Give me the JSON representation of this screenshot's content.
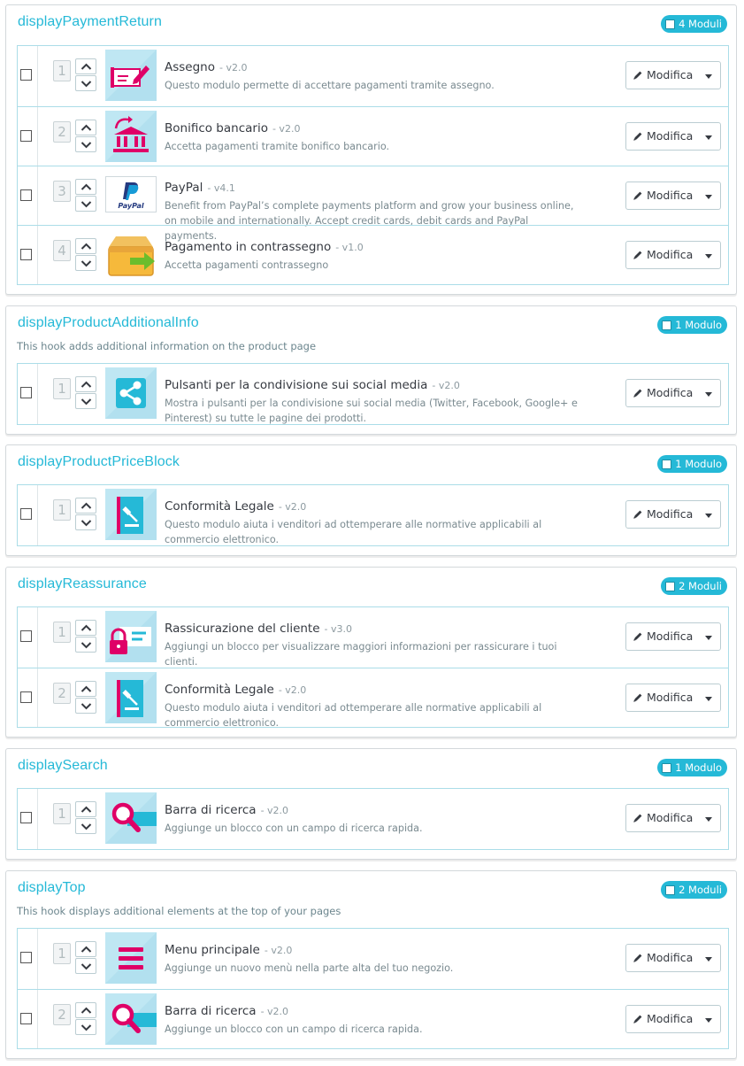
{
  "edit_label": "Modifica",
  "hooks": [
    {
      "title": "displayPaymentReturn",
      "description": "",
      "badge": "4 Moduli",
      "modules": [
        {
          "position": "1",
          "name": "Assegno",
          "version": "- v2.0",
          "description": "Questo modulo permette di accettare pagamenti tramite assegno.",
          "icon": "cheque-icon"
        },
        {
          "position": "2",
          "name": "Bonifico bancario",
          "version": "- v2.0",
          "description": "Accetta pagamenti tramite bonifico bancario.",
          "icon": "bank-transfer-icon"
        },
        {
          "position": "3",
          "name": "PayPal",
          "version": "- v4.1",
          "description": "Benefit from PayPal’s complete payments platform and grow your business online, on mobile and internationally. Accept credit cards, debit cards and PayPal payments.",
          "icon": "paypal-logo",
          "logo_text": "PayPal"
        },
        {
          "position": "4",
          "name": "Pagamento in contrassegno",
          "version": "- v1.0",
          "description": "Accetta pagamenti contrassegno",
          "icon": "cash-on-delivery-icon"
        }
      ]
    },
    {
      "title": "displayProductAdditionalInfo",
      "description": "This hook adds additional information on the product page",
      "badge": "1 Modulo",
      "modules": [
        {
          "position": "1",
          "name": "Pulsanti per la condivisione sui social media",
          "version": "- v2.0",
          "description": "Mostra i pulsanti per la condivisione sui social media (Twitter, Facebook, Google+ e Pinterest) su tutte le pagine dei prodotti.",
          "icon": "share-icon"
        }
      ]
    },
    {
      "title": "displayProductPriceBlock",
      "description": "",
      "badge": "1 Modulo",
      "modules": [
        {
          "position": "1",
          "name": "Conformità Legale",
          "version": "- v2.0",
          "description": "Questo modulo aiuta i venditori ad ottemperare alle normative applicabili al commercio elettronico.",
          "icon": "legal-gavel-icon"
        }
      ]
    },
    {
      "title": "displayReassurance",
      "description": "",
      "badge": "2 Moduli",
      "modules": [
        {
          "position": "1",
          "name": "Rassicurazione del cliente",
          "version": "- v3.0",
          "description": "Aggiungi un blocco per visualizzare maggiori informazioni per rassicurare i tuoi clienti.",
          "icon": "reassurance-lock-icon"
        },
        {
          "position": "2",
          "name": "Conformità Legale",
          "version": "- v2.0",
          "description": "Questo modulo aiuta i venditori ad ottemperare alle normative applicabili al commercio elettronico.",
          "icon": "legal-gavel-icon"
        }
      ]
    },
    {
      "title": "displaySearch",
      "description": "",
      "badge": "1 Modulo",
      "modules": [
        {
          "position": "1",
          "name": "Barra di ricerca",
          "version": "- v2.0",
          "description": "Aggiunge un blocco con un campo di ricerca rapida.",
          "icon": "search-bar-icon"
        }
      ]
    },
    {
      "title": "displayTop",
      "description": "This hook displays additional elements at the top of your pages",
      "badge": "2 Moduli",
      "modules": [
        {
          "position": "1",
          "name": "Menu principale",
          "version": "- v2.0",
          "description": "Aggiunge un nuovo menù nella parte alta del tuo negozio.",
          "icon": "main-menu-icon"
        },
        {
          "position": "2",
          "name": "Barra di ricerca",
          "version": "- v2.0",
          "description": "Aggiunge un blocco con un campo di ricerca rapida.",
          "icon": "search-bar-icon"
        }
      ]
    }
  ],
  "colors": {
    "accent": "#25b9d7",
    "brand_pink": "#df0067",
    "icon_bg": "#bfe7f3",
    "border": "#abdde8"
  }
}
